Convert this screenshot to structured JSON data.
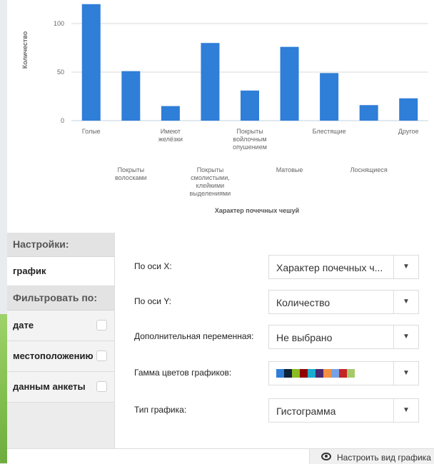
{
  "chart_data": {
    "type": "bar",
    "ylabel": "Количество",
    "xlabel": "Характер почечных чешуй",
    "ylim": [
      0,
      120
    ],
    "yticks": [
      0,
      50,
      100
    ],
    "color": "#2f7ed8",
    "grid": true,
    "categories": [
      "Голые",
      "Покрыты волосками",
      "Имеют желёзки",
      "Покрыты смолистыми, клейкими выделениями",
      "Покрыты войлочным опушением",
      "Матовые",
      "Блестящие",
      "Лоснящиеся",
      "Другое"
    ],
    "values": [
      120,
      51,
      15,
      80,
      31,
      76,
      49,
      16,
      23
    ],
    "label_lines": [
      [
        "Голые"
      ],
      [
        "Покрыты",
        "волосками"
      ],
      [
        "Имеют",
        "желёзки"
      ],
      [
        "Покрыты",
        "смолистыми,",
        "клейкими",
        "выделениями"
      ],
      [
        "Покрыты",
        "войлочным",
        "опушением"
      ],
      [
        "Матовые"
      ],
      [
        "Блестящие"
      ],
      [
        "Лоснящиеся"
      ],
      [
        "Другое"
      ]
    ]
  },
  "sidebar": {
    "settings_header": "Настройки:",
    "graph_item": "график",
    "filter_header": "Фильтровать по:",
    "filters": [
      "дате",
      "местоположению",
      "данным анкеты"
    ]
  },
  "form": {
    "x_axis_label": "По оси X:",
    "x_axis_value": "Характер почечных ч...",
    "y_axis_label": "По оси Y:",
    "y_axis_value": "Количество",
    "extra_var_label": "Дополнительная переменная:",
    "extra_var_value": "Не выбрано",
    "palette_label": "Гамма цветов графиков:",
    "palette_colors": [
      "#2f7ed8",
      "#0d233a",
      "#8bbc21",
      "#910000",
      "#1aadce",
      "#492970",
      "#f28f43",
      "#77a1e5",
      "#c42525",
      "#a6c96a"
    ],
    "chart_type_label": "Тип графика:",
    "chart_type_value": "Гистограмма"
  },
  "footer": {
    "customize_label": "Настроить вид графика"
  }
}
